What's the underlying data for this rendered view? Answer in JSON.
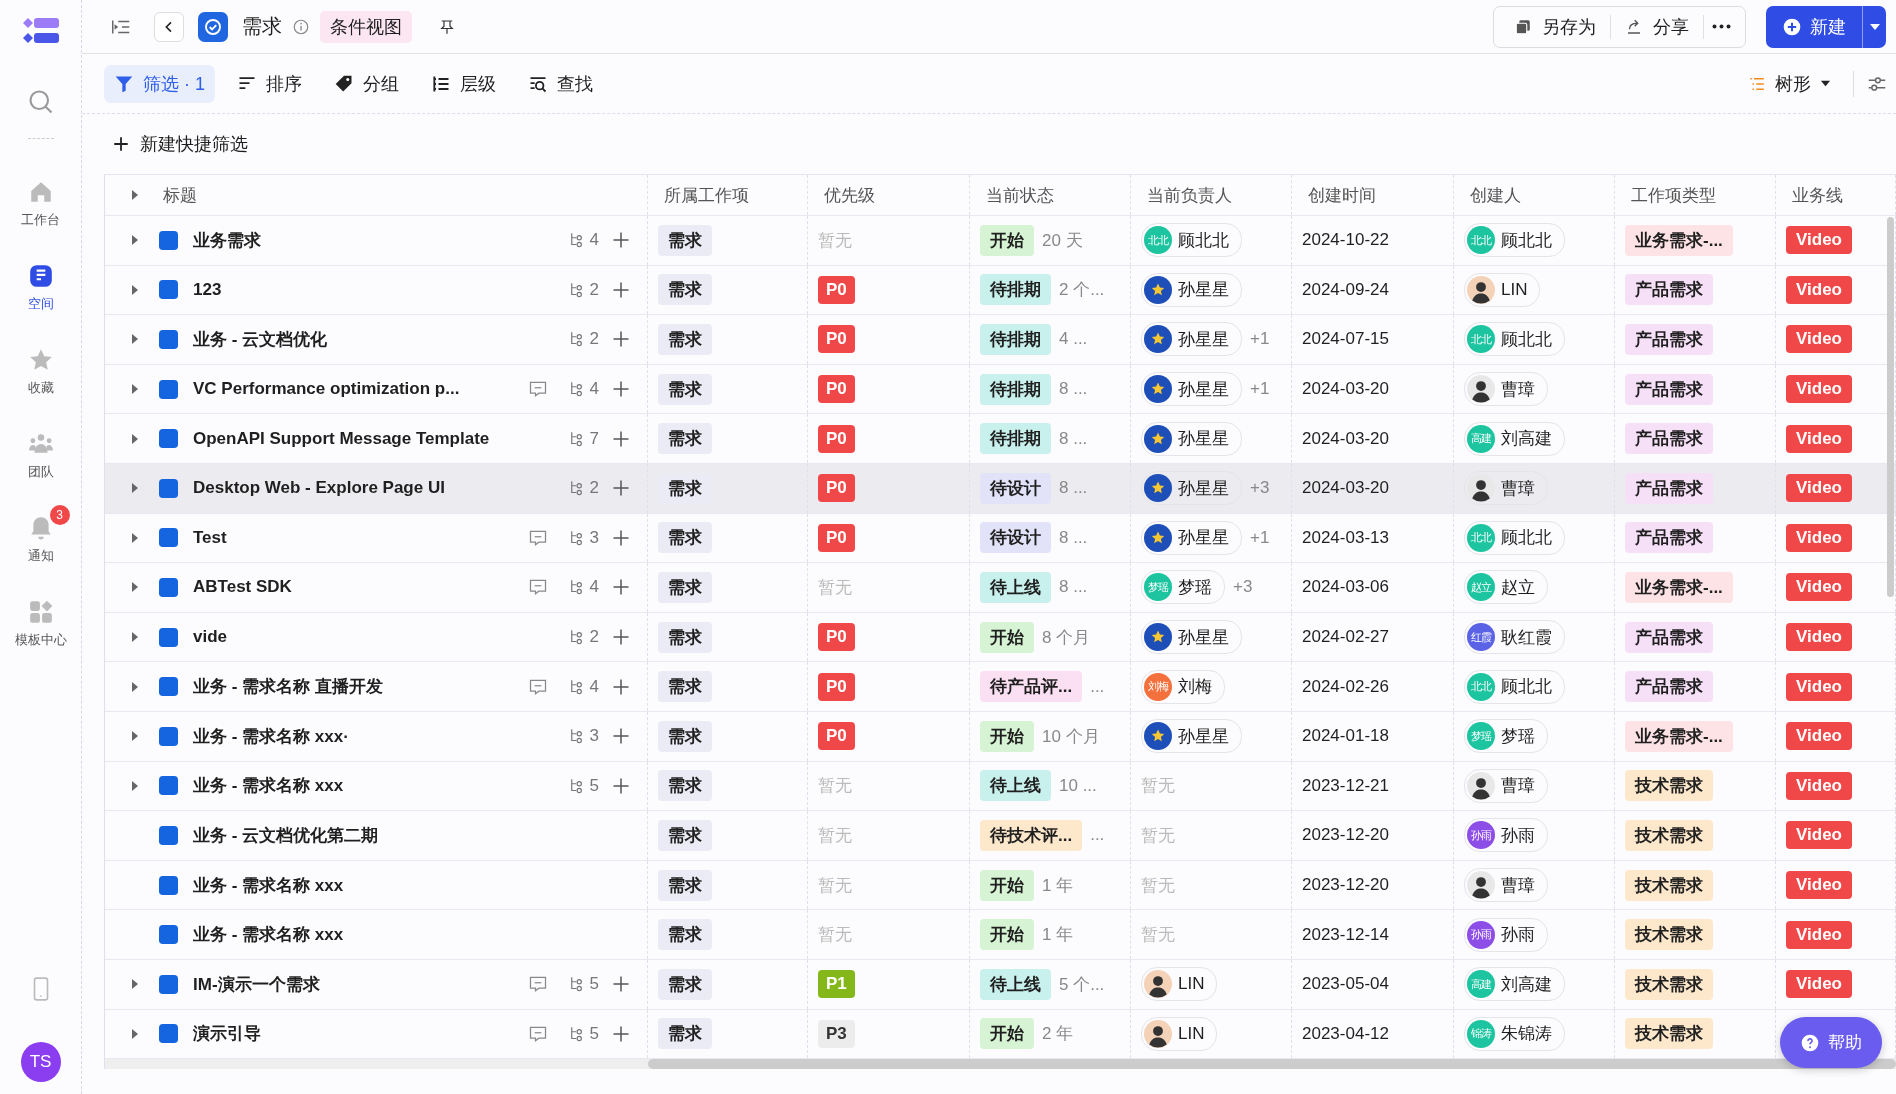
{
  "sidebar": {
    "items": [
      {
        "label": "工作台",
        "selected": false
      },
      {
        "label": "空间",
        "selected": true
      },
      {
        "label": "收藏",
        "selected": false
      },
      {
        "label": "团队",
        "selected": false
      },
      {
        "label": "通知",
        "selected": false,
        "badge": "3"
      },
      {
        "label": "模板中心",
        "selected": false
      }
    ],
    "avatar": "TS"
  },
  "header": {
    "title": "需求",
    "view_tag": "条件视图",
    "actions": [
      "另存为",
      "分享"
    ],
    "new_button": "新建"
  },
  "toolbar": {
    "items": [
      {
        "label": "筛选 · 1",
        "selected": true
      },
      {
        "label": "排序",
        "selected": false
      },
      {
        "label": "分组",
        "selected": false
      },
      {
        "label": "层级",
        "selected": false
      },
      {
        "label": "查找",
        "selected": false
      }
    ],
    "view_mode": "树形"
  },
  "quick_filter": "新建快捷筛选",
  "table": {
    "columns": [
      "标题",
      "所属工作项",
      "优先级",
      "当前状态",
      "当前负责人",
      "创建时间",
      "创建人",
      "工作项类型",
      "业务线"
    ],
    "rows": [
      {
        "title": "业务需求",
        "selected": false,
        "expanded": false,
        "comment": false,
        "subtasks": "4",
        "item": "需求",
        "priority": {
          "kind": "none",
          "label": "暂无"
        },
        "status": {
          "label": "开始",
          "color": "#d6f3d4"
        },
        "duration": "20 天",
        "assignee": {
          "kind": "initials",
          "mark": "北北",
          "color": "#1cc4a0",
          "name": "顾北北"
        },
        "date": "2024-10-22",
        "creator": {
          "kind": "initials",
          "mark": "北北",
          "color": "#1cc4a0",
          "name": "顾北北"
        },
        "type": {
          "label": "业务需求-...",
          "color": "#fde2e6"
        },
        "line": "Video"
      },
      {
        "title": "123",
        "selected": false,
        "expanded": false,
        "comment": false,
        "subtasks": "2",
        "item": "需求",
        "priority": {
          "kind": "p0",
          "label": "P0"
        },
        "status": {
          "label": "待排期",
          "color": "#c8f0ec"
        },
        "duration": "2 个...",
        "assignee": {
          "kind": "star",
          "color": "#1e4fb8",
          "name": "孙星星"
        },
        "date": "2024-09-24",
        "creator": {
          "kind": "photo",
          "color": "#f3d2b8",
          "name": "LIN"
        },
        "type": {
          "label": "产品需求",
          "color": "#f6e0f8"
        },
        "line": "Video"
      },
      {
        "title": "业务 - 云文档优化",
        "selected": false,
        "expanded": false,
        "comment": false,
        "subtasks": "2",
        "item": "需求",
        "priority": {
          "kind": "p0",
          "label": "P0"
        },
        "status": {
          "label": "待排期",
          "color": "#c8f0ec"
        },
        "duration": "4 ...",
        "assignee": {
          "kind": "star",
          "color": "#1e4fb8",
          "name": "孙星星",
          "extra": "+1"
        },
        "date": "2024-07-15",
        "creator": {
          "kind": "initials",
          "mark": "北北",
          "color": "#1cc4a0",
          "name": "顾北北"
        },
        "type": {
          "label": "产品需求",
          "color": "#f6e0f8"
        },
        "line": "Video"
      },
      {
        "title": "VC Performance optimization p...",
        "selected": false,
        "expanded": false,
        "comment": true,
        "subtasks": "4",
        "item": "需求",
        "priority": {
          "kind": "p0",
          "label": "P0"
        },
        "status": {
          "label": "待排期",
          "color": "#c8f0ec"
        },
        "duration": "8 ...",
        "assignee": {
          "kind": "star",
          "color": "#1e4fb8",
          "name": "孙星星",
          "extra": "+1"
        },
        "date": "2024-03-20",
        "creator": {
          "kind": "photo",
          "color": "#e8e8e8",
          "name": "曹璋"
        },
        "type": {
          "label": "产品需求",
          "color": "#f6e0f8"
        },
        "line": "Video"
      },
      {
        "title": "OpenAPI Support Message Template",
        "selected": false,
        "expanded": false,
        "comment": false,
        "subtasks": "7",
        "item": "需求",
        "priority": {
          "kind": "p0",
          "label": "P0"
        },
        "status": {
          "label": "待排期",
          "color": "#c8f0ec"
        },
        "duration": "8 ...",
        "assignee": {
          "kind": "star",
          "color": "#1e4fb8",
          "name": "孙星星"
        },
        "date": "2024-03-20",
        "creator": {
          "kind": "initials",
          "mark": "高建",
          "color": "#1cc4a0",
          "name": "刘高建"
        },
        "type": {
          "label": "产品需求",
          "color": "#f6e0f8"
        },
        "line": "Video"
      },
      {
        "title": "Desktop Web - Explore Page UI",
        "selected": true,
        "expanded": false,
        "comment": false,
        "subtasks": "2",
        "item": "需求",
        "priority": {
          "kind": "p0",
          "label": "P0"
        },
        "status": {
          "label": "待设计",
          "color": "#e2e2f8"
        },
        "duration": "8 ...",
        "assignee": {
          "kind": "star",
          "color": "#1e4fb8",
          "name": "孙星星",
          "extra": "+3"
        },
        "date": "2024-03-20",
        "creator": {
          "kind": "photo",
          "color": "#e8e8e8",
          "name": "曹璋"
        },
        "type": {
          "label": "产品需求",
          "color": "#f6e0f8"
        },
        "line": "Video"
      },
      {
        "title": "Test",
        "selected": false,
        "expanded": false,
        "comment": true,
        "subtasks": "3",
        "item": "需求",
        "priority": {
          "kind": "p0",
          "label": "P0"
        },
        "status": {
          "label": "待设计",
          "color": "#e2e2f8"
        },
        "duration": "8 ...",
        "assignee": {
          "kind": "star",
          "color": "#1e4fb8",
          "name": "孙星星",
          "extra": "+1"
        },
        "date": "2024-03-13",
        "creator": {
          "kind": "initials",
          "mark": "北北",
          "color": "#1cc4a0",
          "name": "顾北北"
        },
        "type": {
          "label": "产品需求",
          "color": "#f6e0f8"
        },
        "line": "Video"
      },
      {
        "title": "ABTest SDK",
        "selected": false,
        "expanded": false,
        "comment": true,
        "subtasks": "4",
        "item": "需求",
        "priority": {
          "kind": "none",
          "label": "暂无"
        },
        "status": {
          "label": "待上线",
          "color": "#c8f0ec"
        },
        "duration": "8 ...",
        "assignee": {
          "kind": "initials",
          "mark": "梦瑶",
          "color": "#1cc4a0",
          "name": "梦瑶",
          "extra": "+3"
        },
        "date": "2024-03-06",
        "creator": {
          "kind": "initials",
          "mark": "赵立",
          "color": "#1cc4a0",
          "name": "赵立"
        },
        "type": {
          "label": "业务需求-...",
          "color": "#fde2e6"
        },
        "line": "Video"
      },
      {
        "title": "vide",
        "selected": false,
        "expanded": false,
        "comment": false,
        "subtasks": "2",
        "item": "需求",
        "priority": {
          "kind": "p0",
          "label": "P0"
        },
        "status": {
          "label": "开始",
          "color": "#d6f3d4"
        },
        "duration": "8 个月",
        "assignee": {
          "kind": "star",
          "color": "#1e4fb8",
          "name": "孙星星"
        },
        "date": "2024-02-27",
        "creator": {
          "kind": "initials",
          "mark": "红霞",
          "color": "#5a62e6",
          "name": "耿红霞"
        },
        "type": {
          "label": "产品需求",
          "color": "#f6e0f8"
        },
        "line": "Video"
      },
      {
        "title": "业务 - 需求名称 直播开发",
        "selected": false,
        "expanded": false,
        "comment": true,
        "subtasks": "4",
        "item": "需求",
        "priority": {
          "kind": "p0",
          "label": "P0"
        },
        "status": {
          "label": "待产品评...",
          "color": "#fbe0f4"
        },
        "duration": "...",
        "assignee": {
          "kind": "initials",
          "mark": "刘梅",
          "color": "#f4713e",
          "name": "刘梅"
        },
        "date": "2024-02-26",
        "creator": {
          "kind": "initials",
          "mark": "北北",
          "color": "#1cc4a0",
          "name": "顾北北"
        },
        "type": {
          "label": "产品需求",
          "color": "#f6e0f8"
        },
        "line": "Video"
      },
      {
        "title": "业务 - 需求名称 xxx·",
        "selected": false,
        "expanded": false,
        "comment": false,
        "subtasks": "3",
        "item": "需求",
        "priority": {
          "kind": "p0",
          "label": "P0"
        },
        "status": {
          "label": "开始",
          "color": "#d6f3d4"
        },
        "duration": "10 个月",
        "assignee": {
          "kind": "star",
          "color": "#1e4fb8",
          "name": "孙星星"
        },
        "date": "2024-01-18",
        "creator": {
          "kind": "initials",
          "mark": "梦瑶",
          "color": "#1cc4a0",
          "name": "梦瑶"
        },
        "type": {
          "label": "业务需求-...",
          "color": "#fde2e6"
        },
        "line": "Video"
      },
      {
        "title": "业务 - 需求名称 xxx",
        "selected": false,
        "expanded": false,
        "comment": false,
        "subtasks": "5",
        "item": "需求",
        "priority": {
          "kind": "none",
          "label": "暂无"
        },
        "status": {
          "label": "待上线",
          "color": "#c8f0ec"
        },
        "duration": "10 ...",
        "assignee": {
          "kind": "none",
          "name": "暂无"
        },
        "date": "2023-12-21",
        "creator": {
          "kind": "photo",
          "color": "#e8e8e8",
          "name": "曹璋"
        },
        "type": {
          "label": "技术需求",
          "color": "#fde8cc"
        },
        "line": "Video"
      },
      {
        "title": "业务 - 云文档优化第二期",
        "selected": false,
        "comment": false,
        "item": "需求",
        "priority": {
          "kind": "none",
          "label": "暂无"
        },
        "status": {
          "label": "待技术评...",
          "color": "#fde8cc"
        },
        "duration": "...",
        "assignee": {
          "kind": "none",
          "name": "暂无"
        },
        "date": "2023-12-20",
        "creator": {
          "kind": "initials",
          "mark": "孙雨",
          "color": "#8d4ee8",
          "name": "孙雨"
        },
        "type": {
          "label": "技术需求",
          "color": "#fde8cc"
        },
        "line": "Video"
      },
      {
        "title": "业务 - 需求名称 xxx",
        "selected": false,
        "comment": false,
        "item": "需求",
        "priority": {
          "kind": "none",
          "label": "暂无"
        },
        "status": {
          "label": "开始",
          "color": "#d6f3d4"
        },
        "duration": "1 年",
        "assignee": {
          "kind": "none",
          "name": "暂无"
        },
        "date": "2023-12-20",
        "creator": {
          "kind": "photo",
          "color": "#e8e8e8",
          "name": "曹璋"
        },
        "type": {
          "label": "技术需求",
          "color": "#fde8cc"
        },
        "line": "Video"
      },
      {
        "title": "业务 - 需求名称 xxx",
        "selected": false,
        "comment": false,
        "item": "需求",
        "priority": {
          "kind": "none",
          "label": "暂无"
        },
        "status": {
          "label": "开始",
          "color": "#d6f3d4"
        },
        "duration": "1 年",
        "assignee": {
          "kind": "none",
          "name": "暂无"
        },
        "date": "2023-12-14",
        "creator": {
          "kind": "initials",
          "mark": "孙雨",
          "color": "#8d4ee8",
          "name": "孙雨"
        },
        "type": {
          "label": "技术需求",
          "color": "#fde8cc"
        },
        "line": "Video"
      },
      {
        "title": "IM-演示一个需求",
        "selected": false,
        "expanded": false,
        "comment": true,
        "subtasks": "5",
        "item": "需求",
        "priority": {
          "kind": "p1",
          "label": "P1"
        },
        "status": {
          "label": "待上线",
          "color": "#c8f0ec"
        },
        "duration": "5 个...",
        "assignee": {
          "kind": "photo",
          "color": "#f3d2b8",
          "name": "LIN"
        },
        "date": "2023-05-04",
        "creator": {
          "kind": "initials",
          "mark": "高建",
          "color": "#1cc4a0",
          "name": "刘高建"
        },
        "type": {
          "label": "技术需求",
          "color": "#fde8cc"
        },
        "line": "Video"
      },
      {
        "title": "演示引导",
        "selected": false,
        "expanded": false,
        "comment": true,
        "subtasks": "5",
        "item": "需求",
        "priority": {
          "kind": "p3",
          "label": "P3"
        },
        "status": {
          "label": "开始",
          "color": "#d6f3d4"
        },
        "duration": "2 年",
        "assignee": {
          "kind": "photo",
          "color": "#f3d2b8",
          "name": "LIN"
        },
        "date": "2023-04-12",
        "creator": {
          "kind": "initials",
          "mark": "锦涛",
          "color": "#1cc4a0",
          "name": "朱锦涛"
        },
        "type": {
          "label": "技术需求",
          "color": "#fde8cc"
        }
      }
    ]
  },
  "help_button": "帮助"
}
